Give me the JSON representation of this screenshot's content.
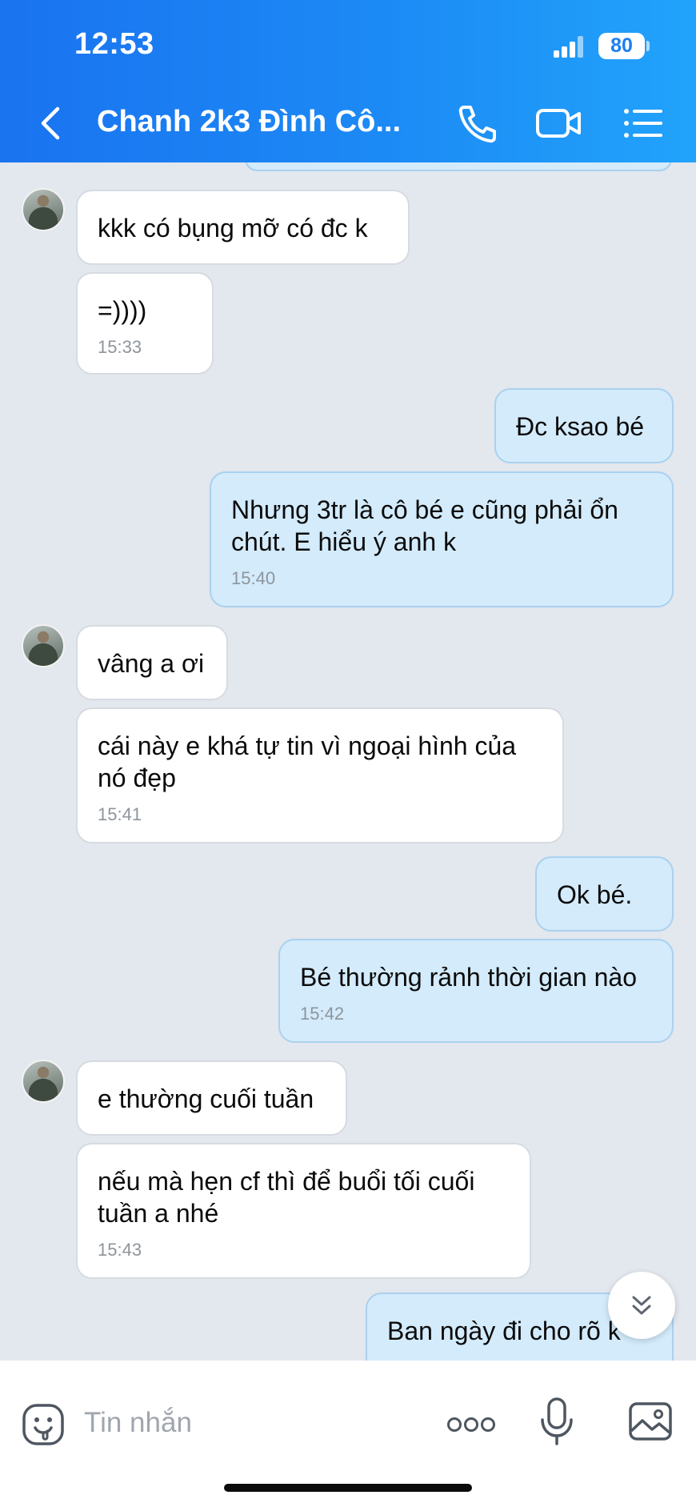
{
  "status_bar": {
    "time": "12:53",
    "battery": "80"
  },
  "header": {
    "title": "Chanh 2k3 Đình Cô...",
    "icons": [
      "back-icon",
      "phone-icon",
      "video-call-icon",
      "menu-list-icon"
    ]
  },
  "messages": [
    {
      "side": "in",
      "text": "kkk có bụng mỡ có đc k"
    },
    {
      "side": "in",
      "text": "=))))",
      "time": "15:33"
    },
    {
      "side": "out",
      "text": "Đc ksao bé"
    },
    {
      "side": "out",
      "text": "Nhưng 3tr là cô bé e cũng phải ổn chút. E hiểu ý anh k",
      "time": "15:40"
    },
    {
      "side": "in",
      "text": "vâng a ơi"
    },
    {
      "side": "in",
      "text": "cái này e khá tự tin vì ngoại hình của nó đẹp",
      "time": "15:41"
    },
    {
      "side": "out",
      "text": "Ok bé."
    },
    {
      "side": "out",
      "text": "Bé thường rảnh thời gian nào",
      "time": "15:42"
    },
    {
      "side": "in",
      "text": "e thường cuối tuần"
    },
    {
      "side": "in",
      "text": "nếu mà hẹn cf thì để buổi tối cuối tuần a nhé",
      "time": "15:43"
    },
    {
      "side": "out",
      "text": "Ban ngày đi cho rõ k"
    }
  ],
  "input_bar": {
    "placeholder": "Tin nhắn",
    "icons": [
      "sticker-icon",
      "more-icon",
      "microphone-icon",
      "image-icon"
    ]
  },
  "colors": {
    "header_gradient": [
      "#1a73f0",
      "#21a3fb"
    ],
    "incoming_bubble": "#ffffff",
    "outgoing_bubble": "#d3ebfb",
    "chat_background": "#e3e7ee"
  }
}
